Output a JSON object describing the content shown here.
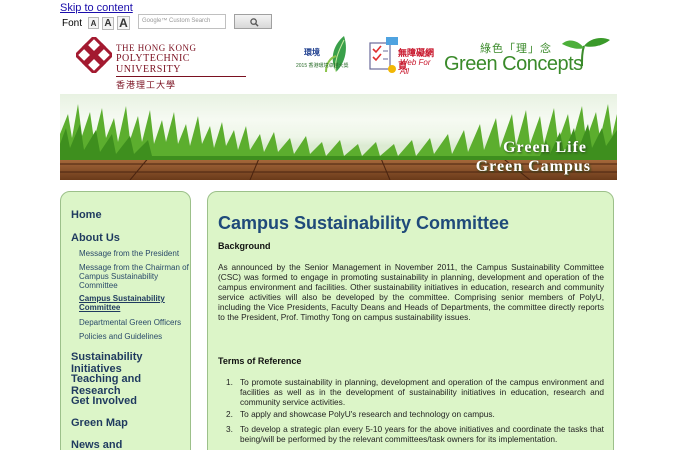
{
  "header": {
    "skip_link": "Skip to content",
    "font_label": "Font",
    "font_sizes": [
      "A",
      "A",
      "A"
    ],
    "search_placeholder": "Google™ Custom Search",
    "logo": {
      "line1": "THE HONG KONG",
      "line2": "POLYTECHNIC UNIVERSITY",
      "line3": "香港理工大學"
    },
    "badge1_text": "環境",
    "badge1_sub": "2015 香港環境卓越大獎",
    "badge2_cn": "無障礙網頁",
    "badge2_en": "Web For All",
    "green_concepts_cn": "綠色「理」念",
    "green_concepts_en": "Green Concepts"
  },
  "banner": {
    "line1": "Green Life",
    "line2": "Green Campus"
  },
  "sidebar": {
    "items": [
      {
        "label": "Home",
        "level": 1
      },
      {
        "label": "About Us",
        "level": 1
      },
      {
        "label": "Message from the President",
        "level": 2
      },
      {
        "label": "Message from the Chairman of Campus Sustainability Committee",
        "level": 2
      },
      {
        "label": "Campus Sustainability Committee",
        "level": 2,
        "active": true
      },
      {
        "label": "Departmental Green Officers",
        "level": 2
      },
      {
        "label": "Policies and Guidelines",
        "level": 2
      },
      {
        "label": "Sustainability Initiatives",
        "level": 1
      },
      {
        "label": "Teaching and Research",
        "level": 1
      },
      {
        "label": "Get Involved",
        "level": 1
      },
      {
        "label": "Green Map",
        "level": 1
      },
      {
        "label": "News and",
        "level": 1
      }
    ]
  },
  "content": {
    "title": "Campus Sustainability Committee",
    "background_heading": "Background",
    "background_text": "As announced by the Senior Management in November 2011, the Campus Sustainability Committee (CSC) was formed to engage in promoting sustainability in planning, development and operation of the campus environment and facilities. Other sustainability initiatives in education, research and community service activities will also be developed by the committee. Comprising senior members of PolyU, including the Vice Presidents, Faculty Deans and Heads of Departments, the committee directly reports to the President, Prof. Timothy Tong on campus sustainability issues.",
    "tor_heading": "Terms of Reference",
    "tor_items": [
      "To promote sustainability in planning, development and operation of the campus environment and facilities as well as in the development of sustainability initiatives in education, research and community service activities.",
      "To apply and showcase PolyU's research and technology on campus.",
      "To develop a strategic plan every 5-10 years for the above initiatives and coordinate the tasks that being/will be performed by the relevant committees/task owners for its implementation."
    ],
    "tor_numbers": [
      "1.",
      "2.",
      "3."
    ]
  }
}
